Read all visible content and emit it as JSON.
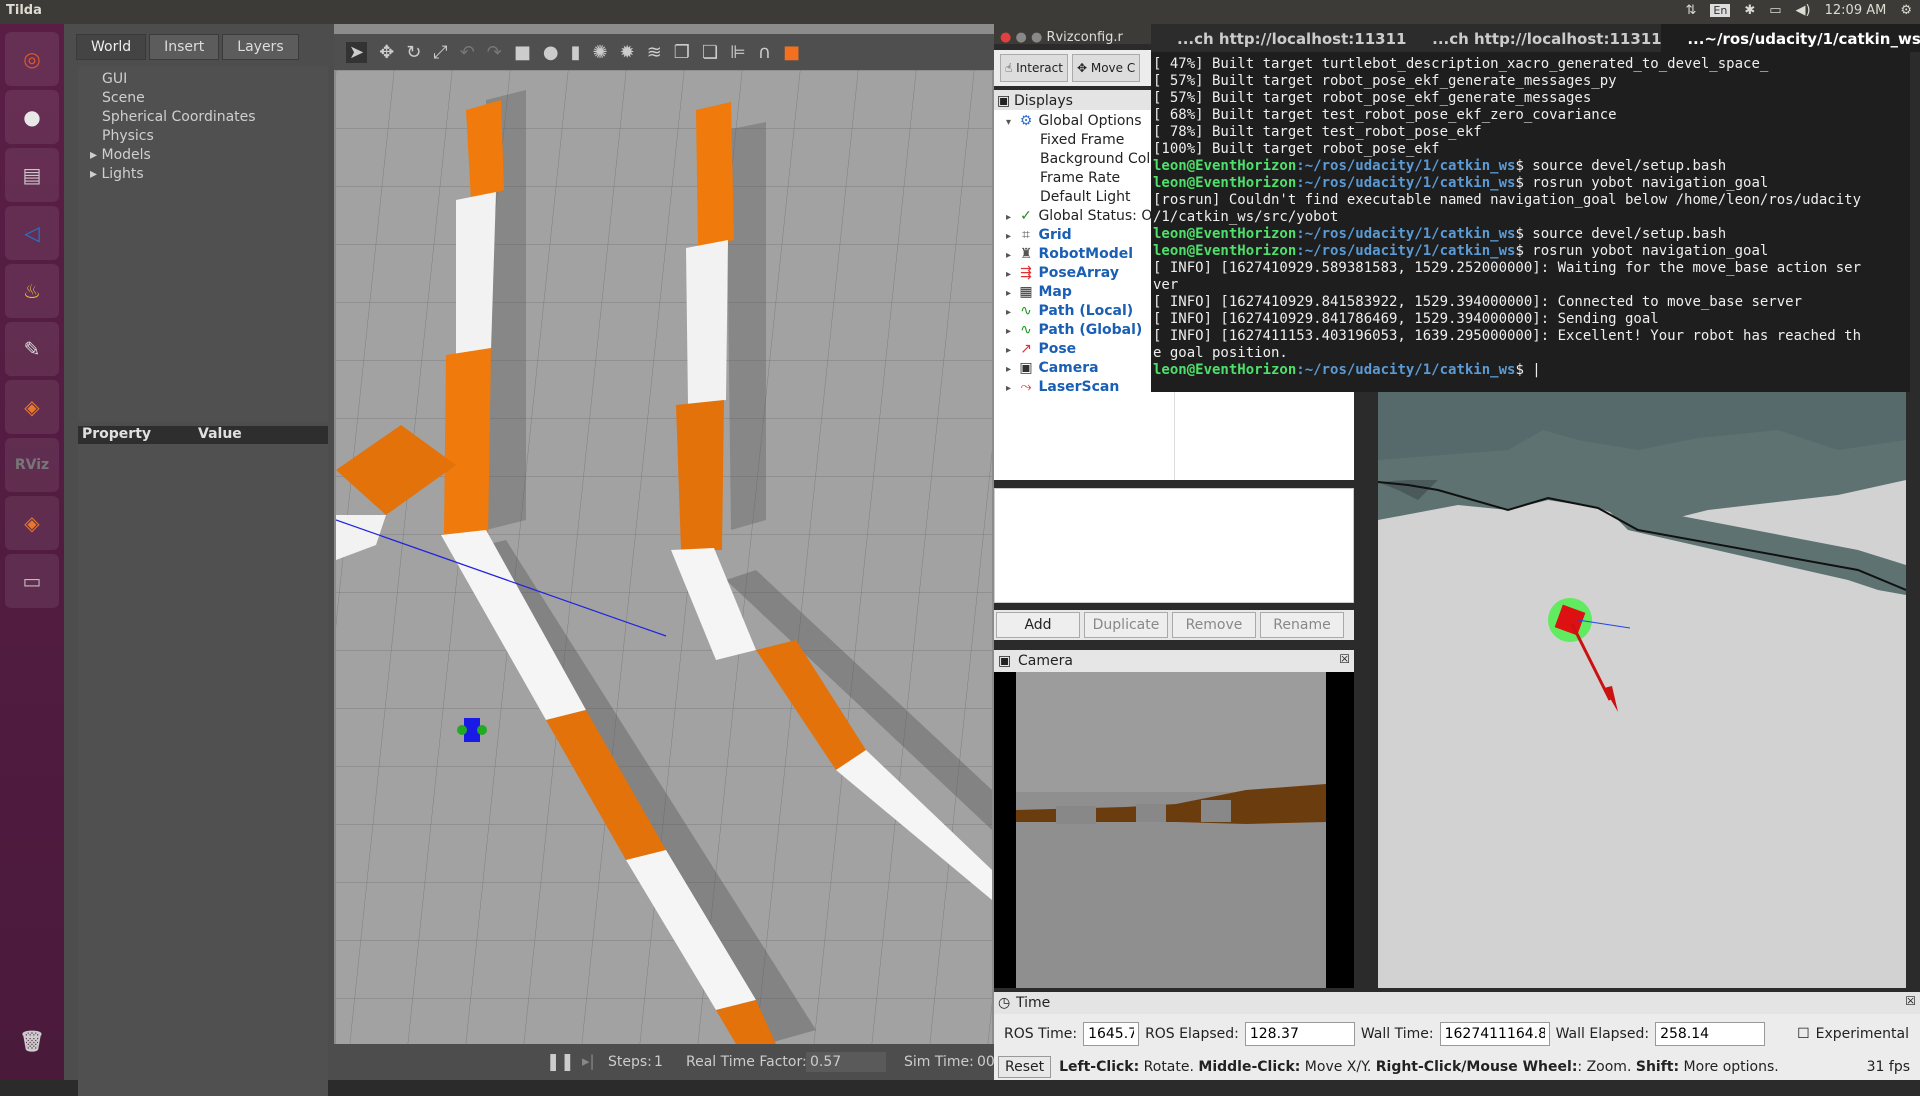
{
  "topbar": {
    "app_title": "Tilda",
    "lang": "En",
    "clock": "12:09 AM"
  },
  "launcher": {
    "items": [
      {
        "name": "ubuntu-dash",
        "glyph": "◎",
        "color": "#e05a2a"
      },
      {
        "name": "chrome",
        "glyph": "●",
        "color": "#e8e8e8"
      },
      {
        "name": "file-manager",
        "glyph": "▤",
        "color": "#c8c8c8"
      },
      {
        "name": "vscode",
        "glyph": "◁",
        "color": "#1f7bd1"
      },
      {
        "name": "tea-app",
        "glyph": "♨",
        "color": "#f2c53d"
      },
      {
        "name": "text-editor",
        "glyph": "✎",
        "color": "#dcdcdc"
      },
      {
        "name": "gazebo",
        "glyph": "◈",
        "color": "#e8772b"
      },
      {
        "name": "rviz",
        "glyph": "RViz",
        "color": "#777777"
      },
      {
        "name": "gazebo-2",
        "glyph": "◈",
        "color": "#e8772b"
      },
      {
        "name": "disk",
        "glyph": "▭",
        "color": "#bdbdbd"
      }
    ],
    "trash": "🗑"
  },
  "gazebo": {
    "tabs": [
      "World",
      "Insert",
      "Layers"
    ],
    "tree": [
      "GUI",
      "Scene",
      "Spherical Coordinates",
      "Physics",
      "Models",
      "Lights"
    ],
    "prop_header": {
      "property": "Property",
      "value": "Value"
    },
    "bottom": {
      "steps_label": "Steps:",
      "steps": "1",
      "rtf_label": "Real Time Factor:",
      "rtf": "0.57",
      "sim_label": "Sim Time:",
      "sim": "00"
    }
  },
  "rviz": {
    "window_title": "Rvizconfig.r",
    "interact": "Interact",
    "move_camera": "Move C",
    "displays_title": "Displays",
    "global_options": "Global Options",
    "opts": [
      "Fixed Frame",
      "Background Colo",
      "Frame Rate",
      "Default Light"
    ],
    "global_status": "Global Status: O",
    "displays": [
      "Grid",
      "RobotModel",
      "PoseArray",
      "Map",
      "Path (Local)",
      "Path (Global)",
      "Pose",
      "Camera",
      "LaserScan"
    ],
    "buttons": [
      "Add",
      "Duplicate",
      "Remove",
      "Rename"
    ],
    "camera_title": "Camera",
    "time_title": "Time",
    "ros_time_label": "ROS Time:",
    "ros_time": "1645.72",
    "ros_elapsed_label": "ROS Elapsed:",
    "ros_elapsed": "128.37",
    "wall_time_label": "Wall Time:",
    "wall_time": "1627411164.80",
    "wall_elapsed_label": "Wall Elapsed:",
    "wall_elapsed": "258.14",
    "experimental": "Experimental",
    "reset": "Reset",
    "hint_b1": "Left-Click:",
    "hint_t1": " Rotate. ",
    "hint_b2": "Middle-Click:",
    "hint_t2": " Move X/Y. ",
    "hint_b3": "Right-Click/Mouse Wheel:",
    "hint_t3": ": Zoom. ",
    "hint_b4": "Shift:",
    "hint_t4": " More options.",
    "fps": "31 fps"
  },
  "terminal": {
    "tabs": [
      "...ch http://localhost:11311",
      "...ch http://localhost:11311",
      "...~/ros/udacity/1/catkin_ws"
    ],
    "lines": [
      {
        "t": "[ 47%] Built target turtlebot_description_xacro_generated_to_devel_space_"
      },
      {
        "t": "[ 57%] Built target robot_pose_ekf_generate_messages_py"
      },
      {
        "t": "[ 57%] Built target robot_pose_ekf_generate_messages"
      },
      {
        "t": "[ 68%] Built target test_robot_pose_ekf_zero_covariance"
      },
      {
        "t": "[ 78%] Built target test_robot_pose_ekf"
      },
      {
        "t": "[100%] Built target robot_pose_ekf"
      },
      {
        "u": "leon@EventHorizon",
        "p": ":~/ros/udacity/1/catkin_ws",
        "t": "$ source devel/setup.bash"
      },
      {
        "u": "leon@EventHorizon",
        "p": ":~/ros/udacity/1/catkin_ws",
        "t": "$ rosrun yobot navigation_goal"
      },
      {
        "t": "[rosrun] Couldn't find executable named navigation_goal below /home/leon/ros/udacity"
      },
      {
        "t": "/1/catkin_ws/src/yobot"
      },
      {
        "u": "leon@EventHorizon",
        "p": ":~/ros/udacity/1/catkin_ws",
        "t": "$ source devel/setup.bash"
      },
      {
        "u": "leon@EventHorizon",
        "p": ":~/ros/udacity/1/catkin_ws",
        "t": "$ rosrun yobot navigation_goal"
      },
      {
        "t": "[ INFO] [1627410929.589381583, 1529.252000000]: Waiting for the move_base action ser"
      },
      {
        "t": "ver"
      },
      {
        "t": "[ INFO] [1627410929.841583922, 1529.394000000]: Connected to move_base server"
      },
      {
        "t": "[ INFO] [1627410929.841786469, 1529.394000000]: Sending goal"
      },
      {
        "t": "[ INFO] [1627411153.403196053, 1639.295000000]: Excellent! Your robot has reached th"
      },
      {
        "t": "e goal position."
      },
      {
        "u": "leon@EventHorizon",
        "p": ":~/ros/udacity/1/catkin_ws",
        "t": "$ |"
      }
    ]
  }
}
